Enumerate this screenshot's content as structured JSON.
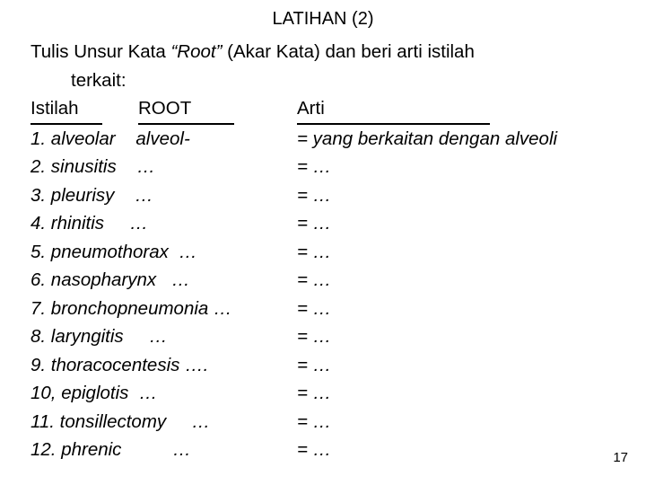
{
  "slide": {
    "title": "LATIHAN (2)",
    "intro_line1_part1": "Tulis Unsur Kata ",
    "intro_line1_italic": "“Root”",
    "intro_line1_part2": " (Akar Kata) dan beri arti istilah",
    "intro_line2": "terkait:",
    "headers": {
      "istilah": "Istilah",
      "root": "ROOT",
      "arti": "Arti"
    },
    "rows": [
      {
        "term": "1. alveolar",
        "root": "alveol-",
        "meaning": "= yang berkaitan dengan alveoli"
      },
      {
        "term": "2. sinusitis",
        "root": "…",
        "meaning": "= …"
      },
      {
        "term": "3. pleurisy",
        "root": "…",
        "meaning": "= …"
      },
      {
        "term": "4. rhinitis",
        "root": "…",
        "meaning": "= …"
      },
      {
        "term": "5. pneumothorax",
        "root": "…",
        "meaning": "= …"
      },
      {
        "term": "6. nasopharynx",
        "root": "…",
        "meaning": "= …"
      },
      {
        "term": "7. bronchopneumonia",
        "root": "…",
        "meaning": "= …"
      },
      {
        "term": "8. laryngitis",
        "root": "…",
        "meaning": "= …"
      },
      {
        "term": "9. thoracocentesis",
        "root": "….",
        "meaning": "= …"
      },
      {
        "term": "10, epiglotis",
        "root": "…",
        "meaning": "= …"
      },
      {
        "term": "11. tonsillectomy",
        "root": "…",
        "meaning": "= …"
      },
      {
        "term": "12. phrenic",
        "root": "…",
        "meaning": "= …"
      }
    ],
    "page_number": "17"
  }
}
